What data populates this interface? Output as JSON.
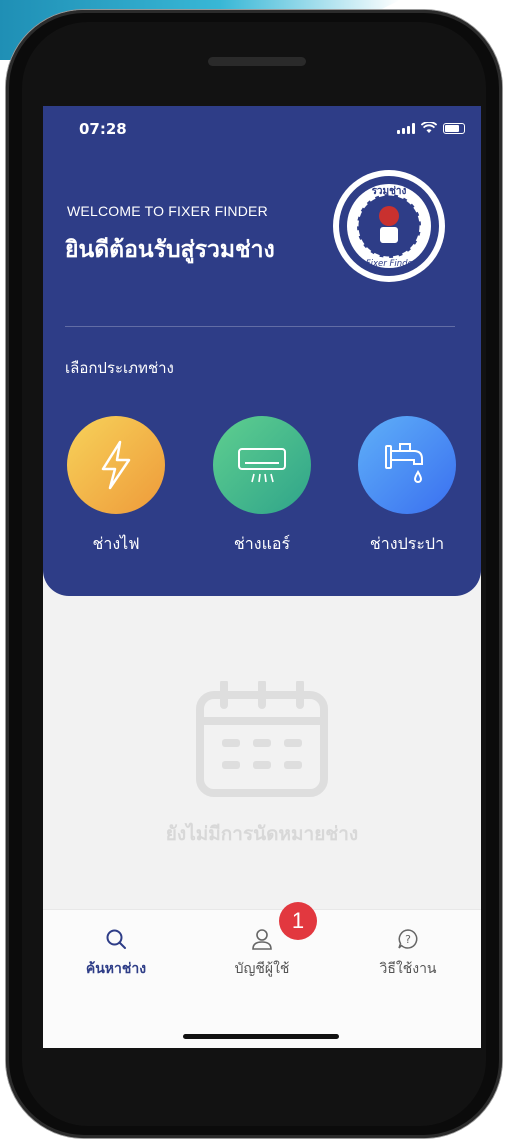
{
  "status_bar": {
    "time": "07:28"
  },
  "header": {
    "welcome_en": "WELCOME TO FIXER FINDER",
    "welcome_th": "ยินดีต้อนรับสู่รวมช่าง",
    "logo_top_text": "รวมช่าง",
    "logo_bottom_text": "Fixer Finder"
  },
  "categories_section": {
    "label": "เลือกประเภทช่าง",
    "items": [
      {
        "label": "ช่างไฟ",
        "icon": "lightning-icon",
        "color": "#f2b33f"
      },
      {
        "label": "ช่างแอร์",
        "icon": "air-conditioner-icon",
        "color": "#3eb58a"
      },
      {
        "label": "ช่างประปา",
        "icon": "faucet-icon",
        "color": "#4a8ef0"
      }
    ]
  },
  "empty_state": {
    "icon": "calendar-icon",
    "text": "ยังไม่มีการนัดหมายช่าง"
  },
  "tabbar": {
    "tabs": [
      {
        "label": "ค้นหาช่าง",
        "icon": "search-icon",
        "active": true
      },
      {
        "label": "บัญชีผู้ใช้",
        "icon": "user-icon",
        "active": false
      },
      {
        "label": "วิธีใช้งาน",
        "icon": "help-icon",
        "active": false
      }
    ],
    "badge": "1"
  },
  "colors": {
    "primary": "#2e3d87",
    "badge": "#e2383f"
  }
}
